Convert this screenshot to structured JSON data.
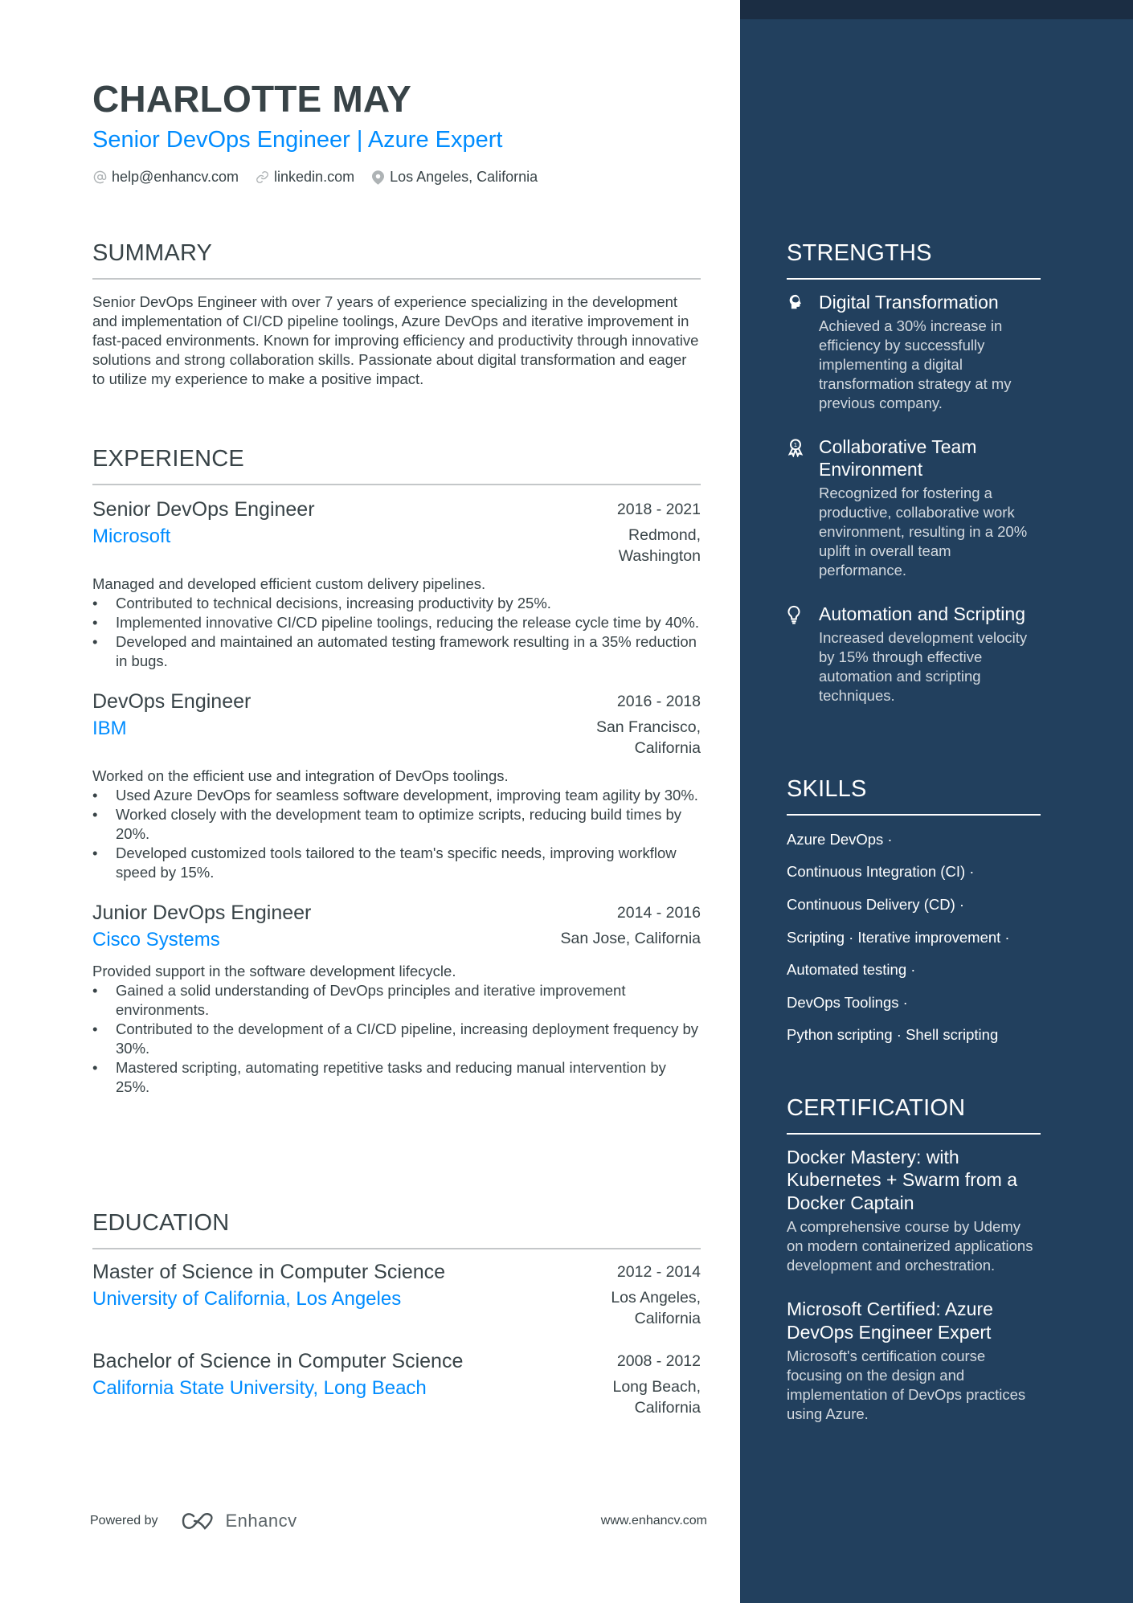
{
  "header": {
    "name": "CHARLOTTE MAY",
    "title": "Senior DevOps Engineer | Azure Expert",
    "contacts": [
      {
        "icon": "at-icon",
        "text": "help@enhancv.com"
      },
      {
        "icon": "link-icon",
        "text": "linkedin.com"
      },
      {
        "icon": "location-pin-icon",
        "text": "Los Angeles, California"
      }
    ]
  },
  "summary": {
    "heading": "SUMMARY",
    "text": "Senior DevOps Engineer with over 7 years of experience specializing in the development and implementation of CI/CD pipeline toolings, Azure DevOps and iterative improvement in fast-paced environments. Known for improving efficiency and productivity through innovative solutions and strong collaboration skills. Passionate about digital transformation and eager to utilize my experience to make a positive impact."
  },
  "experience": {
    "heading": "EXPERIENCE",
    "jobs": [
      {
        "title": "Senior DevOps Engineer",
        "dates": "2018 - 2021",
        "company": "Microsoft",
        "location_line1": "Redmond,",
        "location_line2": "Washington",
        "description": "Managed and developed efficient custom delivery pipelines.",
        "bullets": [
          "Contributed to technical decisions, increasing productivity by 25%.",
          "Implemented innovative CI/CD pipeline toolings, reducing the release cycle time by 40%.",
          "Developed and maintained an automated testing framework resulting in a 35% reduction in bugs."
        ]
      },
      {
        "title": "DevOps Engineer",
        "dates": "2016 - 2018",
        "company": "IBM",
        "location_line1": "San Francisco,",
        "location_line2": "California",
        "description": "Worked on the efficient use and integration of DevOps toolings.",
        "bullets": [
          "Used Azure DevOps for seamless software development, improving team agility by 30%.",
          "Worked closely with the development team to optimize scripts, reducing build times by 20%.",
          "Developed customized tools tailored to the team's specific needs, improving workflow speed by 15%."
        ]
      },
      {
        "title": "Junior DevOps Engineer",
        "dates": "2014 - 2016",
        "company": "Cisco Systems",
        "location_line1": "San Jose, California",
        "location_line2": "",
        "description": "Provided support in the software development lifecycle.",
        "bullets": [
          "Gained a solid understanding of DevOps principles and iterative improvement environments.",
          "Contributed to the development of a CI/CD pipeline, increasing deployment frequency by 30%.",
          "Mastered scripting, automating repetitive tasks and reducing manual intervention by 25%."
        ]
      }
    ]
  },
  "education": {
    "heading": "EDUCATION",
    "items": [
      {
        "degree": "Master of Science in Computer Science",
        "dates": "2012 - 2014",
        "school": "University of California, Los Angeles",
        "location_line1": "Los Angeles,",
        "location_line2": "California"
      },
      {
        "degree": "Bachelor of Science in Computer Science",
        "dates": "2008 - 2012",
        "school": "California State University, Long Beach",
        "location_line1": "Long Beach,",
        "location_line2": "California"
      }
    ]
  },
  "footer": {
    "powered_by": "Powered by",
    "brand": "Enhancv",
    "url": "www.enhancv.com"
  },
  "strengths": {
    "heading": "STRENGTHS",
    "items": [
      {
        "icon": "head-icon",
        "title": "Digital Transformation",
        "description": "Achieved a 30% increase in efficiency by successfully implementing a digital transformation strategy at my previous company."
      },
      {
        "icon": "award-icon",
        "title": "Collaborative Team Environment",
        "description": "Recognized for fostering a productive, collaborative work environment, resulting in a 20% uplift in overall team performance."
      },
      {
        "icon": "lightbulb-icon",
        "title": "Automation and Scripting",
        "description": "Increased development velocity by 15% through effective automation and scripting techniques."
      }
    ]
  },
  "skills": {
    "heading": "SKILLS",
    "lines": [
      "Azure DevOps ·",
      "Continuous Integration (CI) ·",
      "Continuous Delivery (CD) ·",
      "Scripting · Iterative improvement ·",
      "Automated testing ·",
      "DevOps Toolings ·",
      "Python scripting · Shell scripting"
    ]
  },
  "certification": {
    "heading": "CERTIFICATION",
    "items": [
      {
        "title": "Docker Mastery: with Kubernetes + Swarm from a Docker Captain",
        "description": "A comprehensive course by Udemy on modern containerized applications development and orchestration."
      },
      {
        "title": "Microsoft Certified: Azure DevOps Engineer Expert",
        "description": "Microsoft's certification course focusing on the design and implementation of DevOps practices using Azure."
      }
    ]
  },
  "colors": {
    "accent": "#008cff",
    "text": "#384347",
    "sidebar": "#22405e",
    "sidebar_top": "#1b2d43"
  }
}
